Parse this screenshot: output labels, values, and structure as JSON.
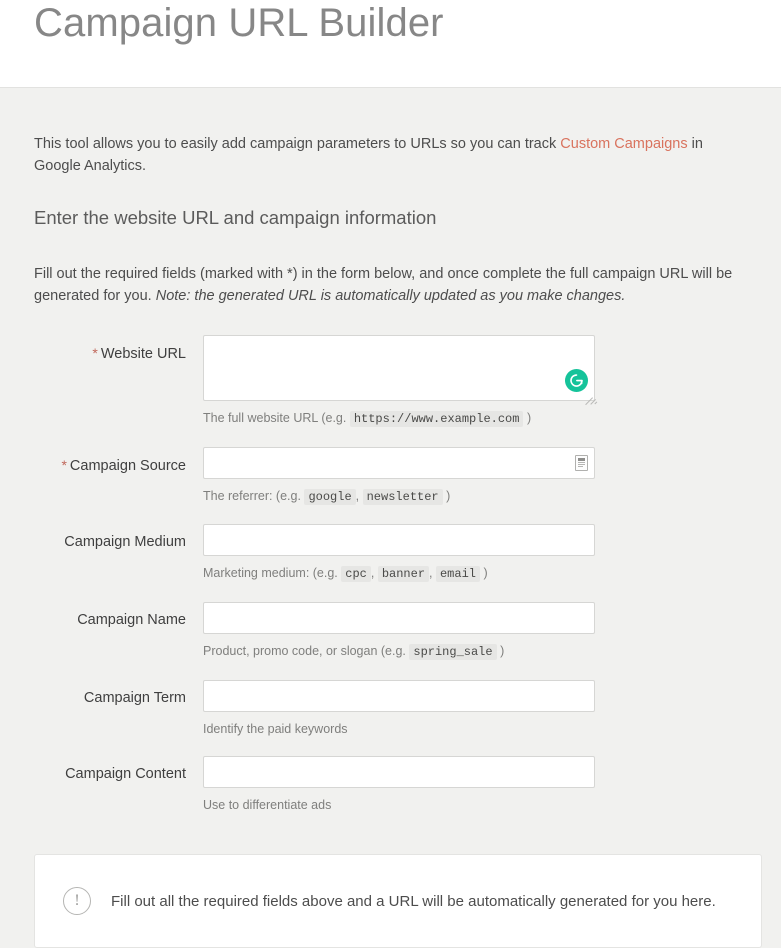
{
  "header": {
    "title": "Campaign URL Builder"
  },
  "intro": {
    "before_link": "This tool allows you to easily add campaign parameters to URLs so you can track ",
    "link_text": "Custom Campaigns",
    "after_link": " in Google Analytics."
  },
  "section_heading": "Enter the website URL and campaign information",
  "instructions": {
    "main": "Fill out the required fields (marked with *) in the form below, and once complete the full campaign URL will be generated for you. ",
    "note": "Note: the generated URL is automatically updated as you make changes."
  },
  "form": {
    "fields": [
      {
        "id": "website-url",
        "label": "Website URL",
        "required": true,
        "required_marker": "*",
        "value": "",
        "placeholder": "",
        "control": "textarea",
        "help_prefix": "The full website URL (e.g. ",
        "help_samples": [
          "https://www.example.com"
        ],
        "help_suffix": " )",
        "badge": "grammarly-icon"
      },
      {
        "id": "campaign-source",
        "label": "Campaign Source",
        "required": true,
        "required_marker": "*",
        "value": "",
        "placeholder": "",
        "control": "input",
        "help_prefix": "The referrer: (e.g. ",
        "help_samples": [
          "google",
          "newsletter"
        ],
        "help_suffix": " )",
        "badge": "autofill-icon"
      },
      {
        "id": "campaign-medium",
        "label": "Campaign Medium",
        "required": false,
        "required_marker": "",
        "value": "",
        "placeholder": "",
        "control": "input",
        "help_prefix": "Marketing medium: (e.g. ",
        "help_samples": [
          "cpc",
          "banner",
          "email"
        ],
        "help_suffix": " )",
        "badge": ""
      },
      {
        "id": "campaign-name",
        "label": "Campaign Name",
        "required": false,
        "required_marker": "",
        "value": "",
        "placeholder": "",
        "control": "input",
        "help_prefix": "Product, promo code, or slogan (e.g. ",
        "help_samples": [
          "spring_sale"
        ],
        "help_suffix": " )",
        "badge": ""
      },
      {
        "id": "campaign-term",
        "label": "Campaign Term",
        "required": false,
        "required_marker": "",
        "value": "",
        "placeholder": "",
        "control": "input",
        "help_prefix": "Identify the paid keywords",
        "help_samples": [],
        "help_suffix": "",
        "badge": ""
      },
      {
        "id": "campaign-content",
        "label": "Campaign Content",
        "required": false,
        "required_marker": "",
        "value": "",
        "placeholder": "",
        "control": "input",
        "help_prefix": "Use to differentiate ads",
        "help_samples": [],
        "help_suffix": "",
        "badge": ""
      }
    ]
  },
  "alert": {
    "icon": "exclamation-circle-icon",
    "icon_glyph": "!",
    "message": "Fill out all the required fields above and a URL will be automatically generated for you here."
  },
  "colors": {
    "page_background": "#f1f1ef",
    "header_background": "#ffffff",
    "title_text": "#878787",
    "link": "#d9735e",
    "required_star": "#c0675a",
    "grammarly_green": "#15c39a",
    "body_text": "#4d4d4d",
    "help_text": "#7f7f7d",
    "code_background": "#e6e6e4",
    "input_border": "#d6d6d4"
  }
}
